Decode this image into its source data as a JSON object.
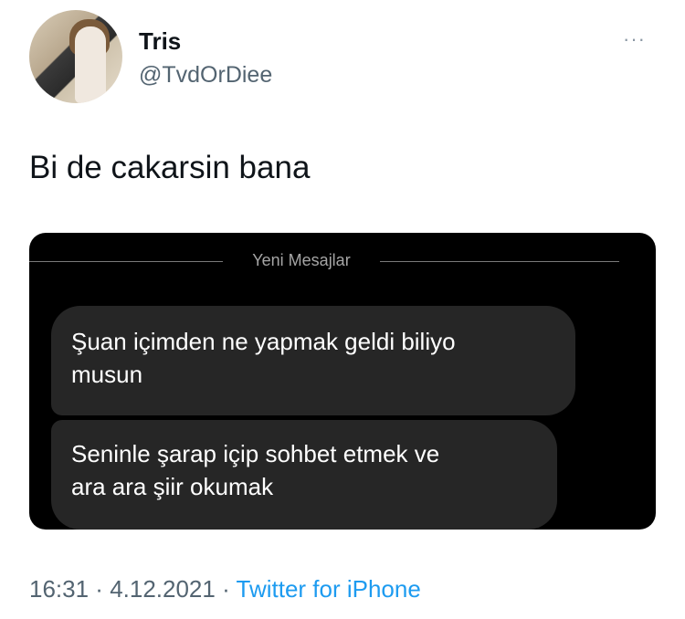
{
  "author": {
    "name": "Tris",
    "handle": "@TvdOrDiee",
    "more_icon": "···"
  },
  "tweet": {
    "text": "Bi de cakarsin bana"
  },
  "media": {
    "divider_label": "Yeni Mesajlar",
    "messages": [
      {
        "line1": "Şuan içimden ne yapmak geldi biliyo",
        "line2": "musun"
      },
      {
        "line1": "Seninle şarap içip sohbet etmek ve",
        "line2": "ara ara şiir okumak"
      }
    ]
  },
  "meta": {
    "time": "16:31",
    "sep1": " · ",
    "date": "4.12.2021",
    "sep2": " · ",
    "source": "Twitter for iPhone"
  },
  "colors": {
    "accent": "#1d9bf0",
    "bubble": "#262626",
    "media_bg": "#000000"
  }
}
